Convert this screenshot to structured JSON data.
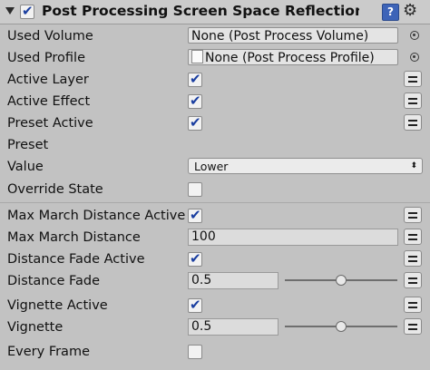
{
  "header": {
    "title": "Post Processing Screen Space Reflections",
    "help_glyph": "?",
    "gear_glyph": "⚙"
  },
  "fields": {
    "used_volume": {
      "label": "Used Volume",
      "value": "None (Post Process Volume)"
    },
    "used_profile": {
      "label": "Used Profile",
      "value": "None (Post Process Profile)"
    },
    "active_layer": {
      "label": "Active Layer",
      "checked": true
    },
    "active_effect": {
      "label": "Active Effect",
      "checked": true
    },
    "preset_active": {
      "label": "Preset Active",
      "checked": true
    },
    "preset": {
      "label": "Preset"
    },
    "value": {
      "label": "Value",
      "selected": "Lower",
      "arrow": "⬍"
    },
    "override_state": {
      "label": "Override State",
      "checked": false
    },
    "max_march_distance_active": {
      "label": "Max March Distance Active",
      "checked": true
    },
    "max_march_distance": {
      "label": "Max March Distance",
      "value": "100"
    },
    "distance_fade_active": {
      "label": "Distance Fade Active",
      "checked": true
    },
    "distance_fade": {
      "label": "Distance Fade",
      "value": "0.5",
      "slider_fraction": 0.5
    },
    "vignette_active": {
      "label": "Vignette Active",
      "checked": true
    },
    "vignette": {
      "label": "Vignette",
      "value": "0.5",
      "slider_fraction": 0.5
    },
    "every_frame": {
      "label": "Every Frame",
      "checked": false
    }
  },
  "check_glyph": "✔",
  "colors": {
    "accent_check": "#1a3ea0",
    "panel_bg": "#c2c2c2",
    "help_icon": "#3d64b8"
  }
}
